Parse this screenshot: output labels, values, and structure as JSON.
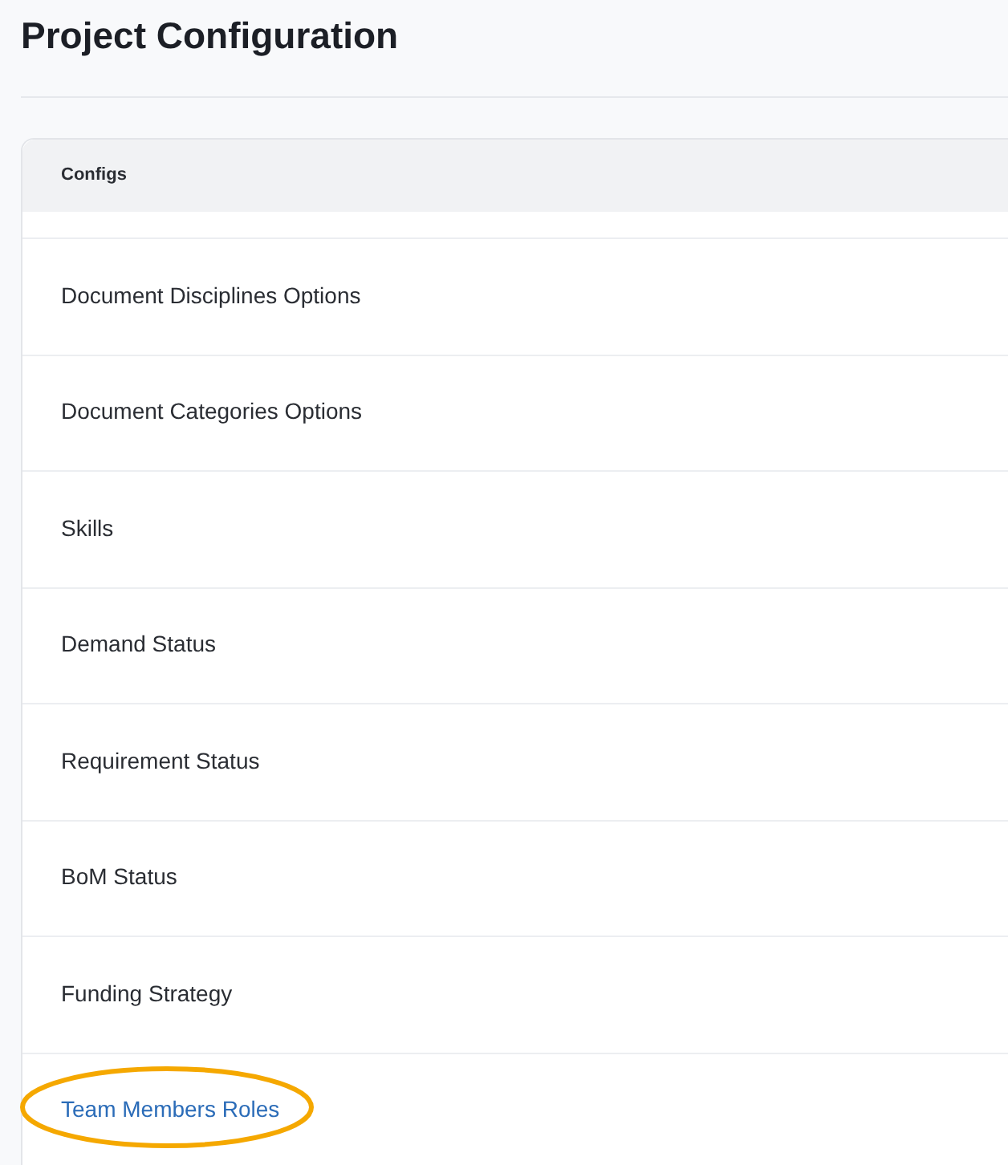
{
  "page": {
    "title": "Project Configuration"
  },
  "table": {
    "header": "Configs",
    "rows": [
      {
        "label": "Document Disciplines Options",
        "active": false,
        "circled": false
      },
      {
        "label": "Document Categories Options",
        "active": false,
        "circled": false
      },
      {
        "label": "Skills",
        "active": false,
        "circled": false
      },
      {
        "label": "Demand Status",
        "active": false,
        "circled": false
      },
      {
        "label": "Requirement Status",
        "active": false,
        "circled": false
      },
      {
        "label": "BoM Status",
        "active": false,
        "circled": false
      },
      {
        "label": "Funding Strategy",
        "active": false,
        "circled": false
      },
      {
        "label": "Team Members Roles",
        "active": true,
        "circled": true
      }
    ]
  }
}
